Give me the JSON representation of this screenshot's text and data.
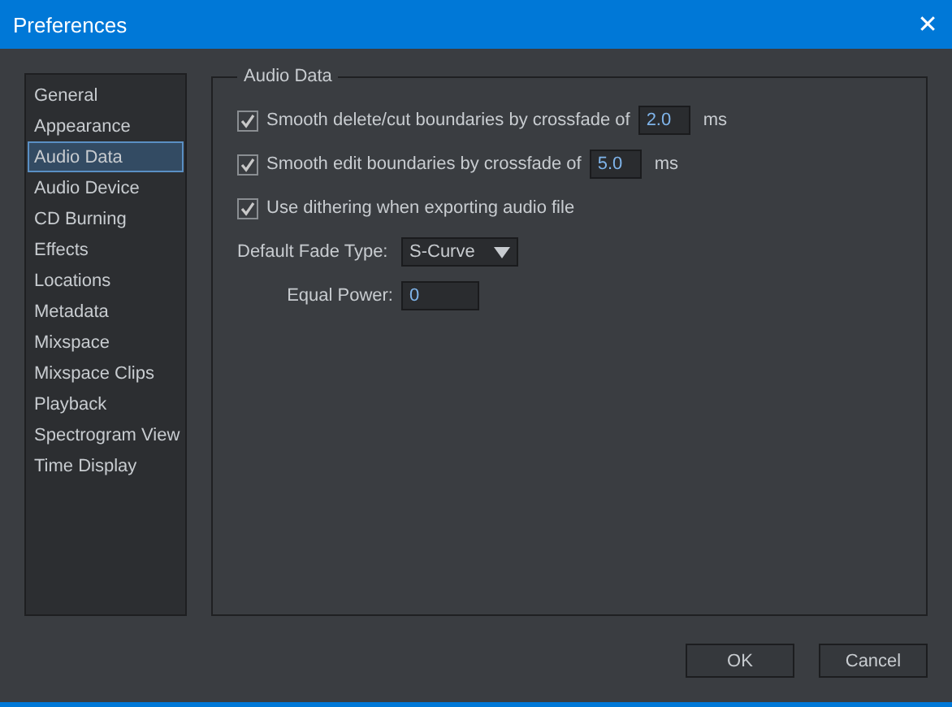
{
  "window": {
    "title": "Preferences",
    "close": "✕"
  },
  "sidebar": {
    "items": [
      {
        "label": "General",
        "selected": false
      },
      {
        "label": "Appearance",
        "selected": false
      },
      {
        "label": "Audio Data",
        "selected": true
      },
      {
        "label": "Audio Device",
        "selected": false
      },
      {
        "label": "CD Burning",
        "selected": false
      },
      {
        "label": "Effects",
        "selected": false
      },
      {
        "label": "Locations",
        "selected": false
      },
      {
        "label": "Metadata",
        "selected": false
      },
      {
        "label": "Mixspace",
        "selected": false
      },
      {
        "label": "Mixspace Clips",
        "selected": false
      },
      {
        "label": "Playback",
        "selected": false
      },
      {
        "label": "Spectrogram View",
        "selected": false
      },
      {
        "label": "Time Display",
        "selected": false
      }
    ]
  },
  "group": {
    "title": "Audio Data",
    "options": [
      {
        "kind": "checkbox-field",
        "label": "Smooth delete/cut boundaries by crossfade of",
        "checked": true,
        "value": "2.0",
        "unit": "ms"
      },
      {
        "kind": "checkbox-field",
        "label": "Smooth edit boundaries by crossfade of",
        "checked": true,
        "value": "5.0",
        "unit": "ms"
      },
      {
        "kind": "checkbox",
        "label": "Use dithering when exporting audio file",
        "checked": true
      },
      {
        "kind": "dropdown",
        "label": "Default Fade Type:",
        "value": "S-Curve"
      },
      {
        "kind": "field",
        "label": "Equal Power:",
        "value": "0"
      }
    ]
  },
  "buttons": [
    "OK",
    "Cancel"
  ]
}
